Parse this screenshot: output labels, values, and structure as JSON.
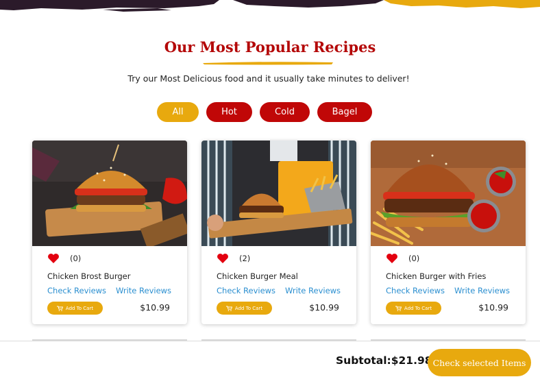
{
  "section": {
    "title": "Our Most Popular Recipes",
    "subtitle": "Try our Most Delicious food and it usually take minutes to deliver!"
  },
  "filters": [
    {
      "label": "All",
      "active": true
    },
    {
      "label": "Hot",
      "active": false
    },
    {
      "label": "Cold",
      "active": false
    },
    {
      "label": "Bagel",
      "active": false
    }
  ],
  "cards": [
    {
      "name": "Chicken Brost Burger",
      "likes": "(0)",
      "check_reviews": "Check Reviews",
      "write_reviews": "Write Reviews",
      "add_to_cart": "Add To Cart",
      "price": "$10.99",
      "image_icon": "burger-photo"
    },
    {
      "name": "Chicken Burger Meal",
      "likes": "(2)",
      "check_reviews": "Check Reviews",
      "write_reviews": "Write Reviews",
      "add_to_cart": "Add To Cart",
      "price": "$10.99",
      "image_icon": "burger-meal-photo"
    },
    {
      "name": "Chicken Burger with Fries",
      "likes": "(0)",
      "check_reviews": "Check Reviews",
      "write_reviews": "Write Reviews",
      "add_to_cart": "Add To Cart",
      "price": "$10.99",
      "image_icon": "burger-fries-photo"
    }
  ],
  "footer": {
    "subtotal": "Subtotal:$21.98",
    "check_button": "Check selected Items"
  },
  "colors": {
    "accent": "#e8a90e",
    "brand_red": "#c00707",
    "title_red": "#b40707",
    "link_blue": "#2b8fd0",
    "heart_red": "#e3000f"
  }
}
